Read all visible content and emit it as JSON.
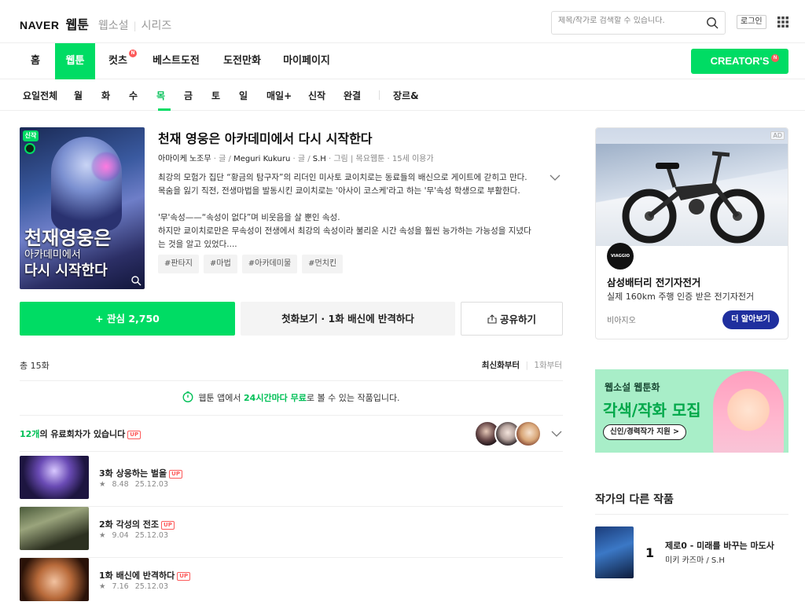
{
  "header": {
    "logo": "NAVER",
    "service": "웹툰",
    "links": [
      "웹소설",
      "시리즈"
    ],
    "search_placeholder": "제목/작가로 검색할 수 있습니다.",
    "login": "로그인"
  },
  "nav": {
    "items": [
      "홈",
      "웹툰",
      "컷츠",
      "베스트도전",
      "도전만화",
      "마이페이지"
    ],
    "active": "웹툰",
    "new_badge": "N",
    "creators": "CREATOR'S"
  },
  "days": {
    "items": [
      "요일전체",
      "월",
      "화",
      "수",
      "목",
      "금",
      "토",
      "일",
      "매일+",
      "신작",
      "완결",
      "장르&"
    ],
    "active": "목"
  },
  "comic": {
    "title": "천재 영웅은 아카데미에서 다시 시작한다",
    "cover_badge": "신작",
    "cover_title_1": "천재영웅은",
    "cover_title_2": "아카데미에서",
    "cover_title_3": "다시 시작한다",
    "author1": "아마이케 노조무",
    "role1": "글",
    "author2": "Meguri Kukuru",
    "role2": "글",
    "author3": "S.H",
    "role3": "그림",
    "day": "목요웹툰",
    "age": "15세 이용가",
    "desc": [
      "최강의 모험가 집단 “황금의 탐구자”의 리더인 미사토 쿄이치로는 동료들의 배신으로 게이트에 갇히고 만다.",
      "목숨을 잃기 직전, 전생마법을 발동시킨 쿄이치로는 '아사이 코스케'라고 하는 '무'속성 학생으로 부활한다.",
      "",
      "'무'속성——“속성이 없다”며 비웃음을 살 뿐인 속성.",
      "하지만 쿄이치로만은 무속성이 전생에서 최강의 속성이라 불리운 시간 속성을 훨씬 능가하는 가능성을 지녔다",
      "는 것을 알고 있었다...."
    ],
    "tags": [
      "#판타지",
      "#마법",
      "#아카데미물",
      "#먼치킨"
    ],
    "fav_button": "+ 관심 2,750",
    "first_button": "첫화보기 · 1화 배신에 반격하다",
    "share_button": "공유하기"
  },
  "episodes_header": {
    "total": "총 15화",
    "sort_new": "최신화부터",
    "sort_old": "1화부터"
  },
  "notice": {
    "prefix": "웹툰 앱에서 ",
    "highlight": "24시간마다 무료",
    "suffix": "로 볼 수 있는 작품입니다."
  },
  "paid": {
    "count": "12개",
    "text": "의 유료회차가 있습니다",
    "up": "UP"
  },
  "episodes": [
    {
      "title": "3화 상응하는 벌을",
      "rating": "8.48",
      "date": "25.12.03",
      "up": "UP"
    },
    {
      "title": "2화 각성의 전조",
      "rating": "9.04",
      "date": "25.12.03",
      "up": "UP"
    },
    {
      "title": "1화 배신에 반격하다",
      "rating": "7.16",
      "date": "25.12.03",
      "up": "UP"
    }
  ],
  "ad": {
    "tag": "AD",
    "logo": "VIAGGIO",
    "headline": "삼성배터리 전기자전거",
    "sub": "실제 160km 주행 인증 받은 전기자전거",
    "brand": "비아지오",
    "cta": "더 알아보기"
  },
  "banner": {
    "line1": "웹소설 웹툰화",
    "line2": "각색/작화 모집",
    "line3": "신인/경력작가 지원 >"
  },
  "other": {
    "title": "작가의 다른 작품",
    "items": [
      {
        "rank": "1",
        "title": "제로0 - 미래를 바꾸는 마도사",
        "author": "미키 카즈마 / S.H"
      }
    ]
  },
  "colors": {
    "accent": "#00dc64",
    "accent_text": "#00c057",
    "badge_red": "#fc5a5a",
    "ad_button": "#1f2f9e"
  }
}
